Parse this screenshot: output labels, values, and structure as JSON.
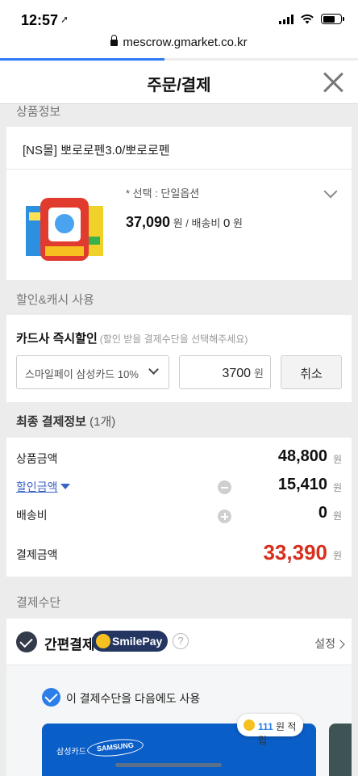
{
  "status_bar": {
    "time": "12:57",
    "location_arrow": "➚"
  },
  "browser": {
    "url": "mescrow.gmarket.co.kr",
    "load_progress": 0.46
  },
  "header": {
    "title": "주문/결제"
  },
  "product_section": {
    "label": "상품정보",
    "name": "[NS몰] 뽀로로펜3.0/뽀로로펜",
    "option": "* 선택 : 단일옵션",
    "price": "37,090",
    "price_unit": "원 / 배송비",
    "shipping": "0",
    "shipping_unit": "원"
  },
  "discount_section": {
    "label": "할인&캐시 사용",
    "title": "카드사 즉시할인",
    "hint": "(할인 받을 결제수단을 선택해주세요)",
    "selected_card": "스마일페이 삼성카드 10%",
    "amount": "3700",
    "amount_unit": "원",
    "cancel_label": "취소"
  },
  "final_payment": {
    "title": "최종 결제정보",
    "count": "(1개)",
    "rows": [
      {
        "label": "상품금액",
        "value": "48,800",
        "unit": "원"
      },
      {
        "label": "할인금액",
        "value": "15,410",
        "unit": "원"
      },
      {
        "label": "배송비",
        "value": "0",
        "unit": "원"
      },
      {
        "label": "결제금액",
        "value": "33,390",
        "unit": "원"
      }
    ]
  },
  "payment_method": {
    "label": "결제수단",
    "title": "간편결제",
    "smilepay_label": "SmilePay",
    "help_label": "?",
    "settings_label": "설정",
    "reuse_label": "이 결제수단을 다음에도 사용",
    "points_value": "111",
    "points_unit": "원 적립",
    "card_issuer": "삼성카드",
    "card_brand": "SAMSUNG"
  },
  "colors": {
    "accent": "#2f7bf5",
    "total_red": "#d6301d",
    "discount_link": "#3a62c4",
    "smilepay_navy": "#243562",
    "card_blue": "#0a5ec8"
  },
  "icons": [
    "location-arrow-icon",
    "signal-icon",
    "wifi-icon",
    "battery-icon",
    "lock-icon",
    "close-icon",
    "chevron-down-icon",
    "minus-circle-icon",
    "plus-circle-icon",
    "check-icon",
    "smile-face-icon",
    "help-icon",
    "chevron-right-icon",
    "coin-icon"
  ]
}
